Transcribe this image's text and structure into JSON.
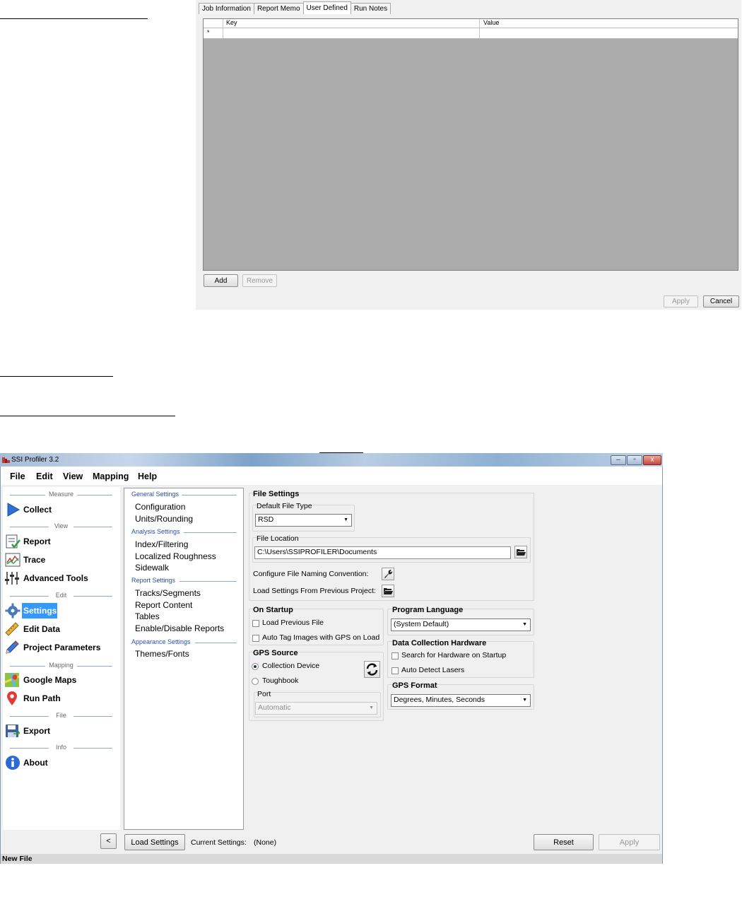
{
  "top_dialog": {
    "tabs": [
      "Job Information",
      "Report Memo",
      "User Defined",
      "Run Notes"
    ],
    "active_tab": "User Defined",
    "grid": {
      "columns": [
        "Key",
        "Value"
      ],
      "new_row_marker": "*"
    },
    "add_label": "Add",
    "remove_label": "Remove",
    "apply_label": "Apply",
    "cancel_label": "Cancel"
  },
  "window": {
    "title": "SSI Profiler 3.2",
    "controls": [
      "–",
      "▫",
      "x"
    ]
  },
  "menu": [
    "File",
    "Edit",
    "View",
    "Mapping",
    "Help"
  ],
  "nav": {
    "headings": [
      "Measure",
      "View",
      "Edit",
      "Mapping",
      "File",
      "Info"
    ],
    "items": [
      {
        "label": "Collect",
        "icon": "play-arrow-icon"
      },
      {
        "label": "Report",
        "icon": "report-icon"
      },
      {
        "label": "Trace",
        "icon": "trace-chart-icon"
      },
      {
        "label": "Advanced Tools",
        "icon": "sliders-icon"
      },
      {
        "label": "Settings",
        "icon": "gear-icon"
      },
      {
        "label": "Edit Data",
        "icon": "ruler-icon"
      },
      {
        "label": "Project Parameters",
        "icon": "pencil-icon"
      },
      {
        "label": "Google Maps",
        "icon": "map-icon"
      },
      {
        "label": "Run Path",
        "icon": "map-pin-icon"
      },
      {
        "label": "Export",
        "icon": "floppy-disk-icon"
      },
      {
        "label": "About",
        "icon": "info-icon"
      }
    ],
    "selected": "Settings",
    "collapse_label": "<"
  },
  "settings_list": {
    "sections": [
      {
        "heading": "General Settings",
        "items": [
          "Configuration",
          "Units/Rounding"
        ]
      },
      {
        "heading": "Analysis Settings",
        "items": [
          "Index/Filtering",
          "Localized Roughness",
          "Sidewalk"
        ]
      },
      {
        "heading": "Report Settings",
        "items": [
          "Tracks/Segments",
          "Report Content",
          "Tables",
          "Enable/Disable Reports"
        ]
      },
      {
        "heading": "Appearance Settings",
        "items": [
          "Themes/Fonts"
        ]
      }
    ]
  },
  "file_settings": {
    "title": "File Settings",
    "default_type_label": "Default File Type",
    "default_type_value": "RSD",
    "location_label": "File Location",
    "location_value": "C:\\Users\\SSIPROFILER\\Documents",
    "naming_label": "Configure File Naming Convention:",
    "load_prev_label": "Load Settings From Previous Project:"
  },
  "on_startup": {
    "title": "On Startup",
    "options": [
      "Load Previous File",
      "Auto Tag Images with GPS on Load"
    ]
  },
  "gps_source": {
    "title": "GPS Source",
    "options": [
      "Collection Device",
      "Toughbook"
    ],
    "selected": "Collection Device",
    "port_label": "Port",
    "port_value": "Automatic"
  },
  "program_language": {
    "title": "Program Language",
    "value": "(System Default)"
  },
  "hardware": {
    "title": "Data Collection Hardware",
    "options": [
      "Search for Hardware on Startup",
      "Auto Detect Lasers"
    ]
  },
  "gps_format": {
    "title": "GPS Format",
    "value": "Degrees, Minutes, Seconds"
  },
  "bottom_bar": {
    "load_settings_label": "Load Settings",
    "current_settings_label": "Current Settings:",
    "current_settings_value": "(None)",
    "reset_label": "Reset",
    "apply_label": "Apply"
  },
  "status": "New File",
  "colors": {
    "selection": "#3399ff",
    "heading_blue": "#2b4fa8",
    "grid_gray": "#ababab"
  }
}
